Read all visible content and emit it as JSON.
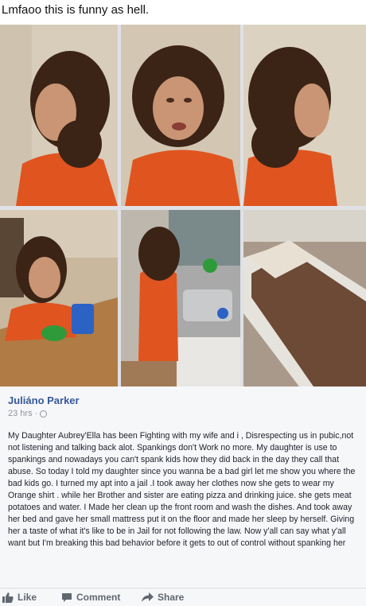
{
  "caption": "Lmfaoo this is funny as hell.",
  "post": {
    "author": "Juliáno Parker",
    "time": "23 hrs",
    "separator": "·",
    "body": "My Daughter Aubrey'Ella has been Fighting with my wife and i , Disrespecting us in pubic,not not listening and talking back alot. Spankings don't Work no more. My daughter is use to spankings and nowadays you can't spank kids how they did back in the day they call that abuse. So today I told my daughter since you wanna be a bad girl let me show you where the bad kids go. I turned my apt into a jail .I took away her clothes now she gets to wear my Orange shirt . while her Brother and sister are eating pizza and drinking juice. she gets meat potatoes and water. I Made her clean up the front room and wash the dishes. And took away her bed and gave her small mattress put it on the floor and made her sleep by herself. Giving her a taste of what it's like to be in Jail for not following the law. Now y'all can say what y'all want but I'm breaking this bad behavior before it gets to out of control without spanking her"
  },
  "actions": {
    "like": "Like",
    "comment": "Comment",
    "share": "Share"
  },
  "icons": {
    "like": "thumbs-up-icon",
    "comment": "comment-icon",
    "share": "share-arrow-icon",
    "privacy": "globe-icon"
  },
  "colors": {
    "author": "#365899",
    "shirt": "#e0541f",
    "meta": "#90949c"
  }
}
